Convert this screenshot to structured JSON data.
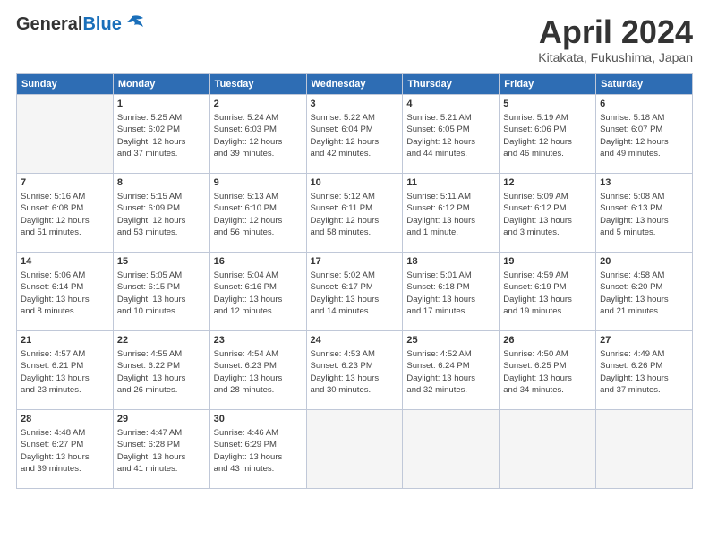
{
  "header": {
    "logo_general": "General",
    "logo_blue": "Blue",
    "month_title": "April 2024",
    "location": "Kitakata, Fukushima, Japan"
  },
  "weekdays": [
    "Sunday",
    "Monday",
    "Tuesday",
    "Wednesday",
    "Thursday",
    "Friday",
    "Saturday"
  ],
  "weeks": [
    [
      {
        "day": "",
        "info": ""
      },
      {
        "day": "1",
        "info": "Sunrise: 5:25 AM\nSunset: 6:02 PM\nDaylight: 12 hours\nand 37 minutes."
      },
      {
        "day": "2",
        "info": "Sunrise: 5:24 AM\nSunset: 6:03 PM\nDaylight: 12 hours\nand 39 minutes."
      },
      {
        "day": "3",
        "info": "Sunrise: 5:22 AM\nSunset: 6:04 PM\nDaylight: 12 hours\nand 42 minutes."
      },
      {
        "day": "4",
        "info": "Sunrise: 5:21 AM\nSunset: 6:05 PM\nDaylight: 12 hours\nand 44 minutes."
      },
      {
        "day": "5",
        "info": "Sunrise: 5:19 AM\nSunset: 6:06 PM\nDaylight: 12 hours\nand 46 minutes."
      },
      {
        "day": "6",
        "info": "Sunrise: 5:18 AM\nSunset: 6:07 PM\nDaylight: 12 hours\nand 49 minutes."
      }
    ],
    [
      {
        "day": "7",
        "info": "Sunrise: 5:16 AM\nSunset: 6:08 PM\nDaylight: 12 hours\nand 51 minutes."
      },
      {
        "day": "8",
        "info": "Sunrise: 5:15 AM\nSunset: 6:09 PM\nDaylight: 12 hours\nand 53 minutes."
      },
      {
        "day": "9",
        "info": "Sunrise: 5:13 AM\nSunset: 6:10 PM\nDaylight: 12 hours\nand 56 minutes."
      },
      {
        "day": "10",
        "info": "Sunrise: 5:12 AM\nSunset: 6:11 PM\nDaylight: 12 hours\nand 58 minutes."
      },
      {
        "day": "11",
        "info": "Sunrise: 5:11 AM\nSunset: 6:12 PM\nDaylight: 13 hours\nand 1 minute."
      },
      {
        "day": "12",
        "info": "Sunrise: 5:09 AM\nSunset: 6:12 PM\nDaylight: 13 hours\nand 3 minutes."
      },
      {
        "day": "13",
        "info": "Sunrise: 5:08 AM\nSunset: 6:13 PM\nDaylight: 13 hours\nand 5 minutes."
      }
    ],
    [
      {
        "day": "14",
        "info": "Sunrise: 5:06 AM\nSunset: 6:14 PM\nDaylight: 13 hours\nand 8 minutes."
      },
      {
        "day": "15",
        "info": "Sunrise: 5:05 AM\nSunset: 6:15 PM\nDaylight: 13 hours\nand 10 minutes."
      },
      {
        "day": "16",
        "info": "Sunrise: 5:04 AM\nSunset: 6:16 PM\nDaylight: 13 hours\nand 12 minutes."
      },
      {
        "day": "17",
        "info": "Sunrise: 5:02 AM\nSunset: 6:17 PM\nDaylight: 13 hours\nand 14 minutes."
      },
      {
        "day": "18",
        "info": "Sunrise: 5:01 AM\nSunset: 6:18 PM\nDaylight: 13 hours\nand 17 minutes."
      },
      {
        "day": "19",
        "info": "Sunrise: 4:59 AM\nSunset: 6:19 PM\nDaylight: 13 hours\nand 19 minutes."
      },
      {
        "day": "20",
        "info": "Sunrise: 4:58 AM\nSunset: 6:20 PM\nDaylight: 13 hours\nand 21 minutes."
      }
    ],
    [
      {
        "day": "21",
        "info": "Sunrise: 4:57 AM\nSunset: 6:21 PM\nDaylight: 13 hours\nand 23 minutes."
      },
      {
        "day": "22",
        "info": "Sunrise: 4:55 AM\nSunset: 6:22 PM\nDaylight: 13 hours\nand 26 minutes."
      },
      {
        "day": "23",
        "info": "Sunrise: 4:54 AM\nSunset: 6:23 PM\nDaylight: 13 hours\nand 28 minutes."
      },
      {
        "day": "24",
        "info": "Sunrise: 4:53 AM\nSunset: 6:23 PM\nDaylight: 13 hours\nand 30 minutes."
      },
      {
        "day": "25",
        "info": "Sunrise: 4:52 AM\nSunset: 6:24 PM\nDaylight: 13 hours\nand 32 minutes."
      },
      {
        "day": "26",
        "info": "Sunrise: 4:50 AM\nSunset: 6:25 PM\nDaylight: 13 hours\nand 34 minutes."
      },
      {
        "day": "27",
        "info": "Sunrise: 4:49 AM\nSunset: 6:26 PM\nDaylight: 13 hours\nand 37 minutes."
      }
    ],
    [
      {
        "day": "28",
        "info": "Sunrise: 4:48 AM\nSunset: 6:27 PM\nDaylight: 13 hours\nand 39 minutes."
      },
      {
        "day": "29",
        "info": "Sunrise: 4:47 AM\nSunset: 6:28 PM\nDaylight: 13 hours\nand 41 minutes."
      },
      {
        "day": "30",
        "info": "Sunrise: 4:46 AM\nSunset: 6:29 PM\nDaylight: 13 hours\nand 43 minutes."
      },
      {
        "day": "",
        "info": ""
      },
      {
        "day": "",
        "info": ""
      },
      {
        "day": "",
        "info": ""
      },
      {
        "day": "",
        "info": ""
      }
    ]
  ]
}
